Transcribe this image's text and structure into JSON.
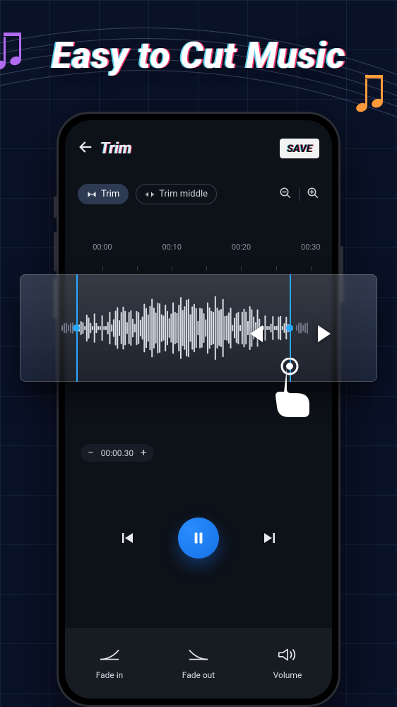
{
  "hero": {
    "title": "Easy to Cut Music"
  },
  "header": {
    "title": "Trim",
    "save_label": "SAVE"
  },
  "modes": {
    "trim": "Trim",
    "trim_middle": "Trim middle"
  },
  "ruler": {
    "marks": [
      "00:00",
      "00:10",
      "00:20",
      "00:30"
    ]
  },
  "time_chip": {
    "value": "00:00.30"
  },
  "bottom": {
    "fade_in": "Fade in",
    "fade_out": "Fade out",
    "volume": "Volume"
  }
}
